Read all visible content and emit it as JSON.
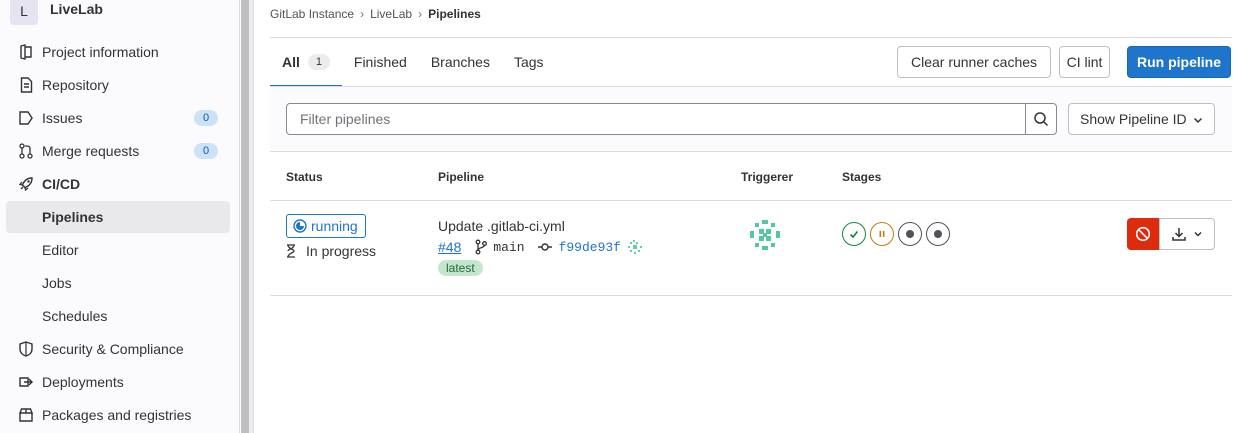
{
  "project": {
    "avatar_letter": "L",
    "name": "LiveLab"
  },
  "sidebar": {
    "items": [
      {
        "label": "Project information",
        "icon": "project-icon"
      },
      {
        "label": "Repository",
        "icon": "doc-icon"
      },
      {
        "label": "Issues",
        "icon": "issues-icon",
        "count": "0"
      },
      {
        "label": "Merge requests",
        "icon": "merge-request-icon",
        "count": "0"
      },
      {
        "label": "CI/CD",
        "icon": "rocket-icon"
      },
      {
        "label": "Pipelines"
      },
      {
        "label": "Editor"
      },
      {
        "label": "Jobs"
      },
      {
        "label": "Schedules"
      },
      {
        "label": "Security & Compliance",
        "icon": "shield-icon"
      },
      {
        "label": "Deployments",
        "icon": "deployments-icon"
      },
      {
        "label": "Packages and registries",
        "icon": "package-icon"
      }
    ]
  },
  "breadcrumb": [
    "GitLab Instance",
    "LiveLab",
    "Pipelines"
  ],
  "tabs": [
    {
      "label": "All",
      "count": "1"
    },
    {
      "label": "Finished"
    },
    {
      "label": "Branches"
    },
    {
      "label": "Tags"
    }
  ],
  "actions": {
    "clear_caches": "Clear runner caches",
    "ci_lint": "CI lint",
    "run_pipeline": "Run pipeline"
  },
  "filter": {
    "placeholder": "Filter pipelines",
    "show_label": "Show Pipeline ID"
  },
  "table": {
    "headers": [
      "Status",
      "Pipeline",
      "Triggerer",
      "Stages"
    ]
  },
  "pipeline": {
    "status": "running",
    "status_detail": "In progress",
    "commit_title": "Update .gitlab-ci.yml",
    "id": "#48",
    "branch": "main",
    "sha": "f99de93f",
    "tag": "latest",
    "stages": [
      "success",
      "running",
      "created",
      "created"
    ]
  },
  "colors": {
    "accent": "#1f75cb",
    "success": "#108548",
    "running_stage": "#c17d10",
    "danger": "#dd2b0e"
  }
}
